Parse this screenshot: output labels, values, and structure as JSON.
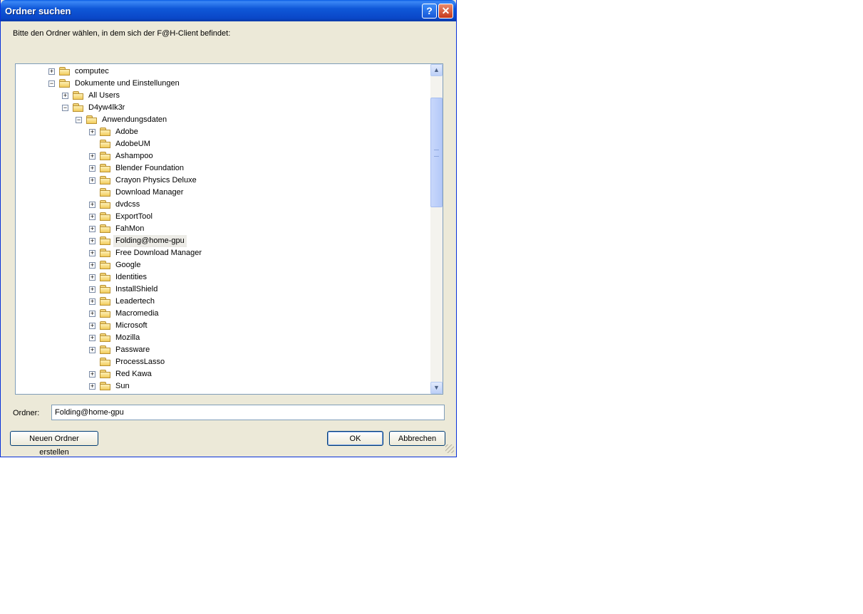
{
  "window": {
    "title": "Ordner suchen"
  },
  "instructions": "Bitte den Ordner wählen, in dem sich der F@H-Client befindet:",
  "tree": [
    {
      "label": "computec",
      "level": 0,
      "expander": "+",
      "selected": false
    },
    {
      "label": "Dokumente und Einstellungen",
      "level": 0,
      "expander": "−",
      "selected": false
    },
    {
      "label": "All Users",
      "level": 1,
      "expander": "+",
      "selected": false
    },
    {
      "label": "D4yw4lk3r",
      "level": 1,
      "expander": "−",
      "selected": false
    },
    {
      "label": "Anwendungsdaten",
      "level": 2,
      "expander": "−",
      "selected": false
    },
    {
      "label": "Adobe",
      "level": 3,
      "expander": "+",
      "selected": false
    },
    {
      "label": "AdobeUM",
      "level": 3,
      "expander": "",
      "selected": false
    },
    {
      "label": "Ashampoo",
      "level": 3,
      "expander": "+",
      "selected": false
    },
    {
      "label": "Blender Foundation",
      "level": 3,
      "expander": "+",
      "selected": false
    },
    {
      "label": "Crayon Physics Deluxe",
      "level": 3,
      "expander": "+",
      "selected": false
    },
    {
      "label": "Download Manager",
      "level": 3,
      "expander": "",
      "selected": false
    },
    {
      "label": "dvdcss",
      "level": 3,
      "expander": "+",
      "selected": false
    },
    {
      "label": "ExportTool",
      "level": 3,
      "expander": "+",
      "selected": false
    },
    {
      "label": "FahMon",
      "level": 3,
      "expander": "+",
      "selected": false
    },
    {
      "label": "Folding@home-gpu",
      "level": 3,
      "expander": "+",
      "selected": true
    },
    {
      "label": "Free Download Manager",
      "level": 3,
      "expander": "+",
      "selected": false
    },
    {
      "label": "Google",
      "level": 3,
      "expander": "+",
      "selected": false
    },
    {
      "label": "Identities",
      "level": 3,
      "expander": "+",
      "selected": false
    },
    {
      "label": "InstallShield",
      "level": 3,
      "expander": "+",
      "selected": false
    },
    {
      "label": "Leadertech",
      "level": 3,
      "expander": "+",
      "selected": false
    },
    {
      "label": "Macromedia",
      "level": 3,
      "expander": "+",
      "selected": false
    },
    {
      "label": "Microsoft",
      "level": 3,
      "expander": "+",
      "selected": false
    },
    {
      "label": "Mozilla",
      "level": 3,
      "expander": "+",
      "selected": false
    },
    {
      "label": "Passware",
      "level": 3,
      "expander": "+",
      "selected": false
    },
    {
      "label": "ProcessLasso",
      "level": 3,
      "expander": "",
      "selected": false
    },
    {
      "label": "Red Kawa",
      "level": 3,
      "expander": "+",
      "selected": false
    },
    {
      "label": "Sun",
      "level": 3,
      "expander": "+",
      "selected": false
    }
  ],
  "folder_field": {
    "label": "Ordner:",
    "value": "Folding@home-gpu"
  },
  "buttons": {
    "new_folder": "Neuen Ordner erstellen",
    "ok": "OK",
    "cancel": "Abbrechen"
  },
  "icons": {
    "help": "help-icon",
    "close": "close-icon",
    "folder": "folder-icon"
  }
}
